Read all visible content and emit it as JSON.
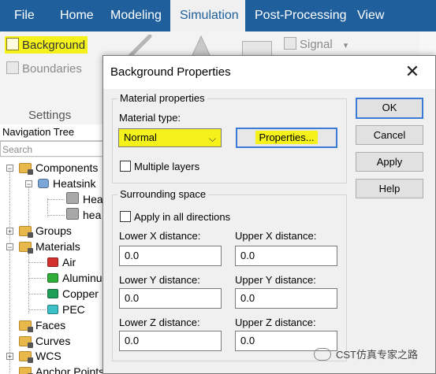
{
  "menu": {
    "items": [
      "File",
      "Home",
      "Modeling",
      "Simulation",
      "Post-Processing",
      "View"
    ],
    "active": "Simulation"
  },
  "ribbon": {
    "background": "Background",
    "boundaries": "Boundaries",
    "signal": "Signal",
    "group_label": "Settings"
  },
  "nav": {
    "title": "Navigation Tree",
    "search_placeholder": "Search",
    "items": {
      "components": "Components",
      "heatsink": "Heatsink",
      "hea": "Hea",
      "hea2": "hea",
      "groups": "Groups",
      "materials": "Materials",
      "air": "Air",
      "aluminum": "Aluminu",
      "copper": "Copper",
      "pec": "PEC",
      "faces": "Faces",
      "curves": "Curves",
      "wcs": "WCS",
      "anchor": "Anchor Points"
    }
  },
  "dialog": {
    "title": "Background Properties",
    "material_group": "Material properties",
    "material_type_label": "Material type:",
    "material_type_value": "Normal",
    "properties_button": "Properties...",
    "multiple_layers": "Multiple layers",
    "space_group": "Surrounding space",
    "apply_all": "Apply in all directions",
    "lower_x_label": "Lower X distance:",
    "upper_x_label": "Upper X distance:",
    "lower_y_label": "Lower Y distance:",
    "upper_y_label": "Upper Y distance:",
    "lower_z_label": "Lower Z distance:",
    "upper_z_label": "Upper Z distance:",
    "lower_x": "0.0",
    "upper_x": "0.0",
    "lower_y": "0.0",
    "upper_y": "0.0",
    "lower_z": "0.0",
    "upper_z": "0.0",
    "ok": "OK",
    "cancel": "Cancel",
    "apply": "Apply",
    "help": "Help"
  },
  "watermark": "CST仿真专家之路",
  "colors": {
    "menubar": "#1e5f9c",
    "highlight": "#f4f21a",
    "default_button_border": "#3a7bd5",
    "air": "#d43030",
    "aluminum": "#2fae3a",
    "copper": "#1f9e58",
    "pec": "#3cc0c8"
  }
}
